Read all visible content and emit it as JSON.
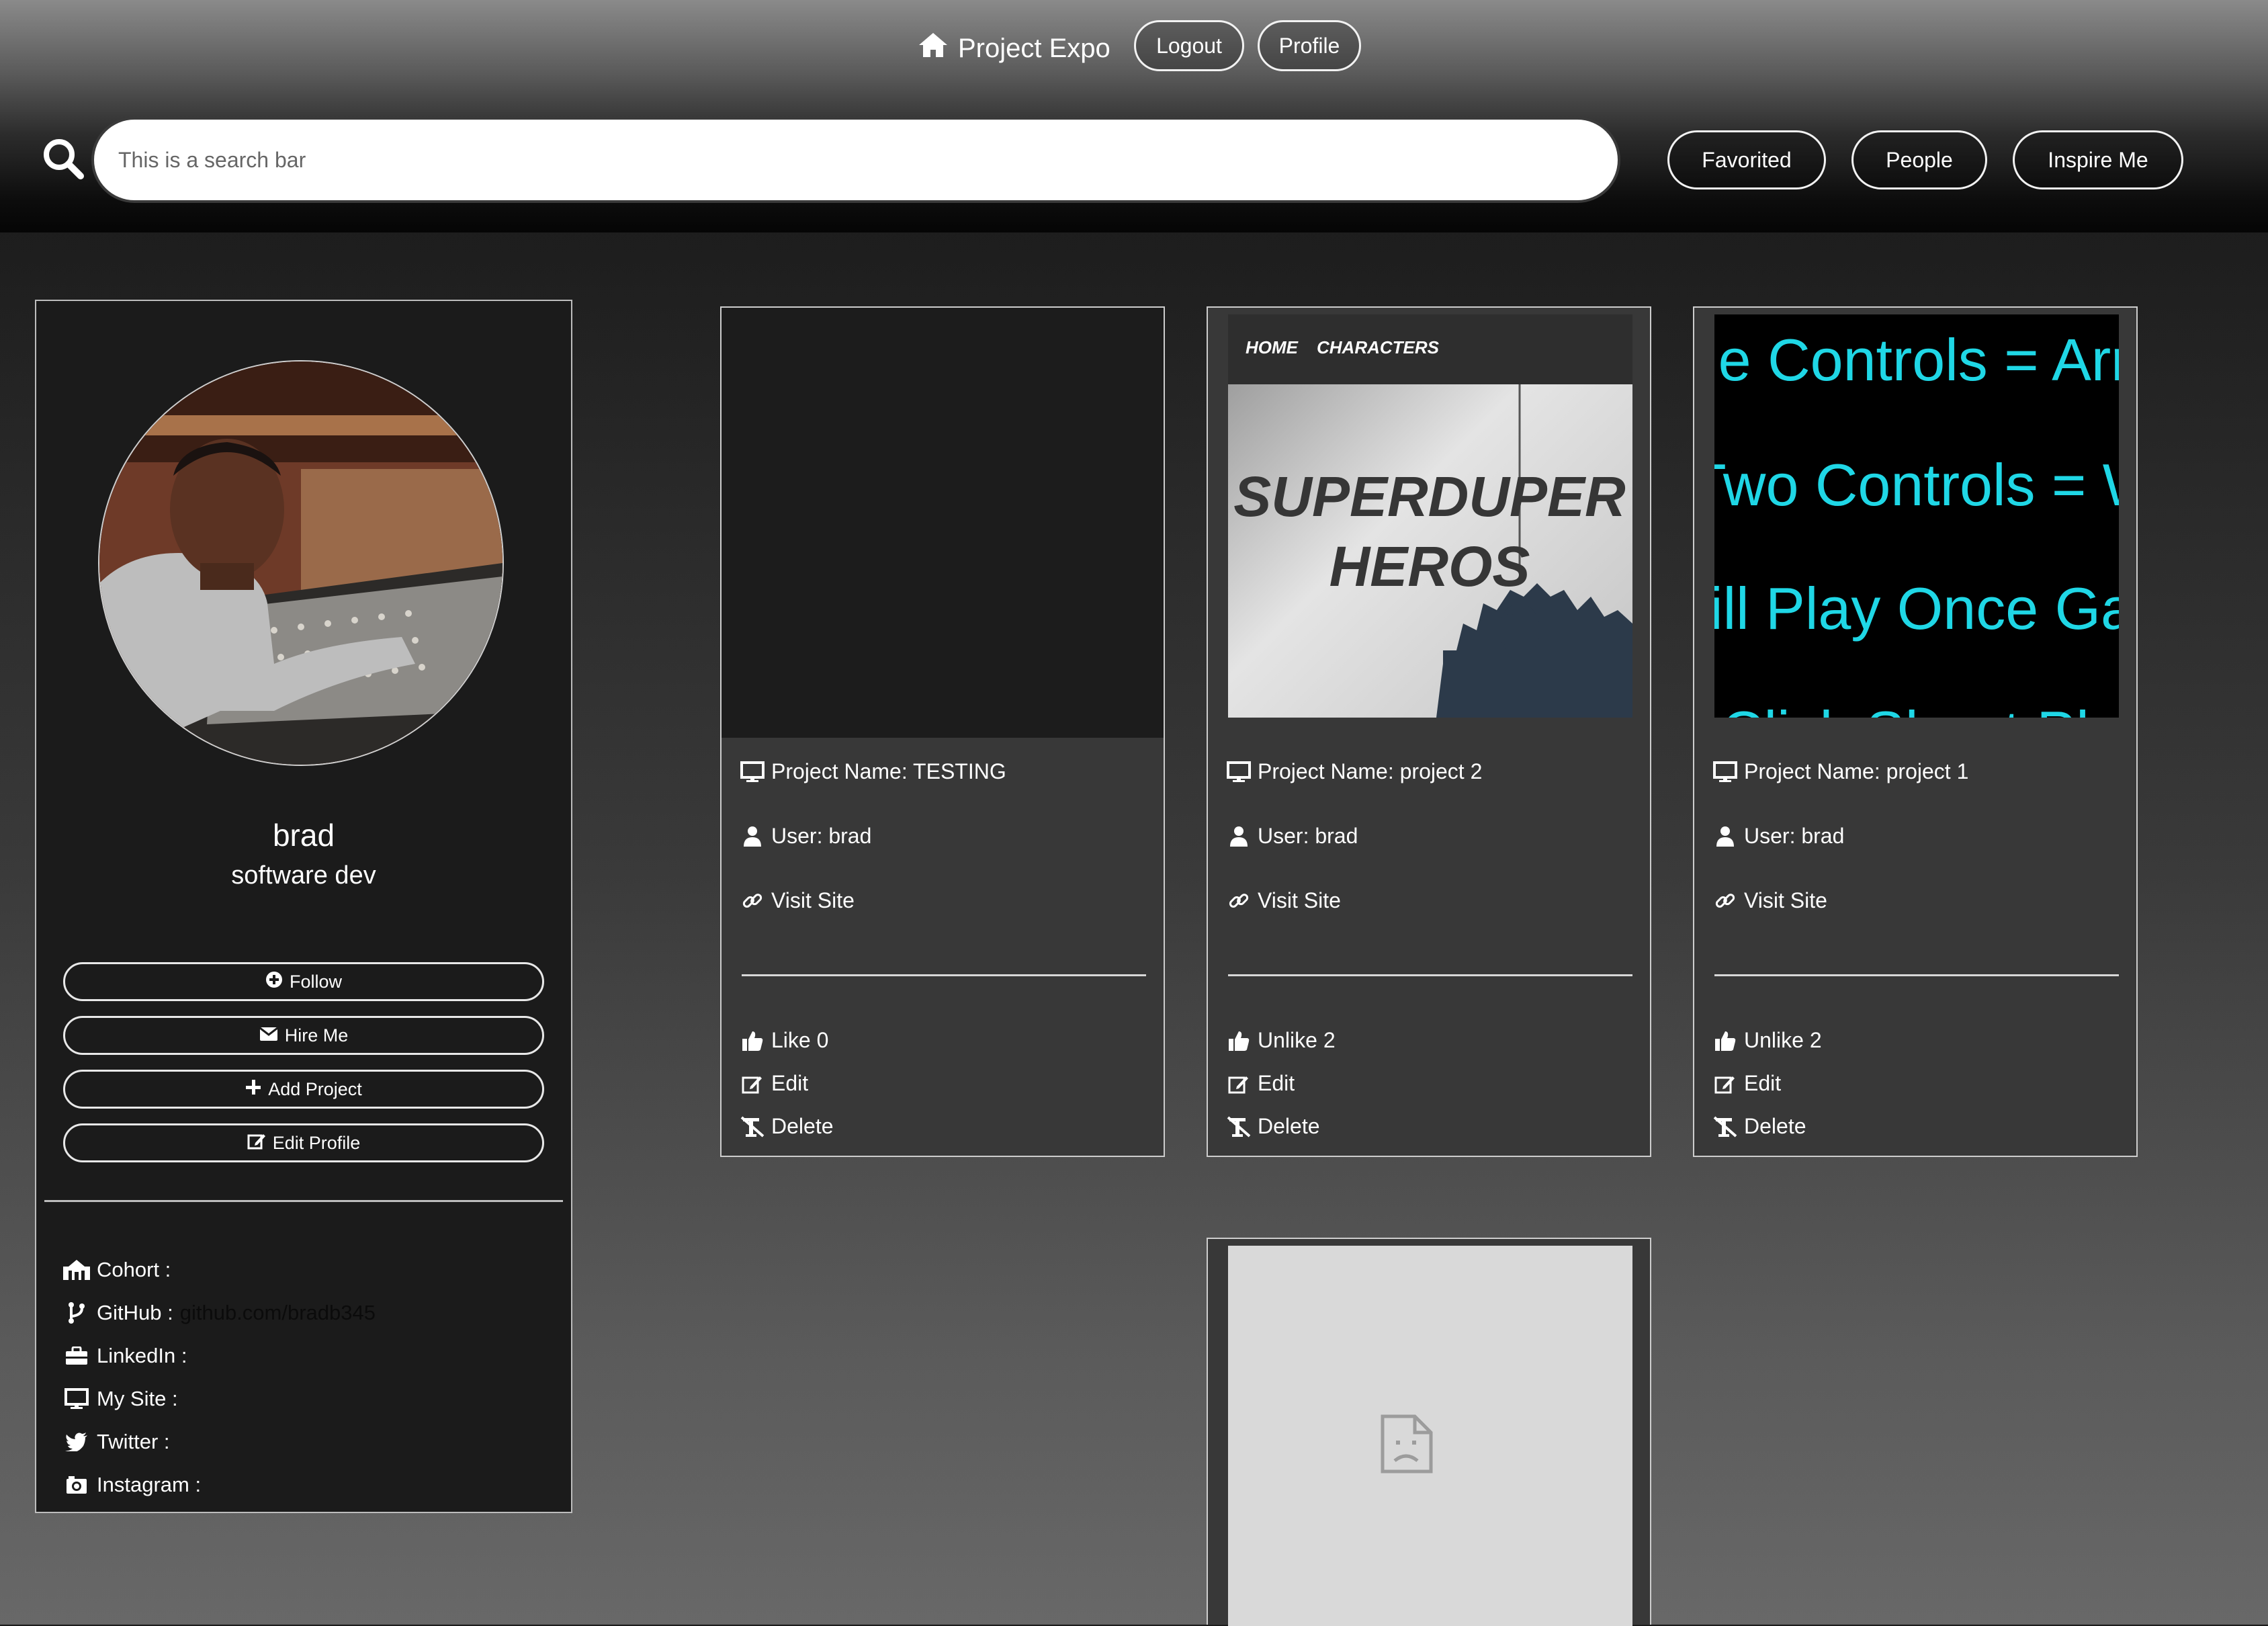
{
  "header": {
    "brand": "Project Expo",
    "logout_label": "Logout",
    "profile_label": "Profile",
    "search_placeholder": "This is a search bar",
    "favorited_label": "Favorited",
    "people_label": "People",
    "inspire_label": "Inspire Me"
  },
  "profile": {
    "name": "brad",
    "title": "software dev",
    "buttons": {
      "follow": "Follow",
      "hire": "Hire Me",
      "add_project": "Add Project",
      "edit_profile": "Edit Profile"
    },
    "info": {
      "cohort_label": "Cohort :",
      "github_label": "GitHub :",
      "github_value": "github.com/bradb345",
      "linkedin_label": "LinkedIn :",
      "mysite_label": "My Site :",
      "twitter_label": "Twitter :",
      "instagram_label": "Instagram :"
    }
  },
  "projects": [
    {
      "name_line": "Project Name: TESTING",
      "user_line": "User: brad",
      "visit": "Visit Site",
      "like": "Like 0",
      "edit": "Edit",
      "delete": "Delete"
    },
    {
      "name_line": "Project Name: project 2",
      "user_line": "User: brad",
      "visit": "Visit Site",
      "like": "Unlike 2",
      "edit": "Edit",
      "delete": "Delete",
      "thumb": {
        "nav_home": "HOME",
        "nav_characters": "CHARACTERS",
        "line1": "SUPERDUPER",
        "line2": "HEROS"
      }
    },
    {
      "name_line": "Project Name: project 1",
      "user_line": "User: brad",
      "visit": "Visit Site",
      "like": "Unlike 2",
      "edit": "Edit",
      "delete": "Delete",
      "thumb": {
        "lines": [
          "Single Controls = Arrow",
          "Two Controls = W",
          "Will Play Once Game",
          "Click Shoot Play"
        ]
      }
    }
  ],
  "colors": {
    "thumb_cyan": "#1fd7e6",
    "card_bg": "#383838",
    "profile_bg": "#1b1b1b"
  }
}
